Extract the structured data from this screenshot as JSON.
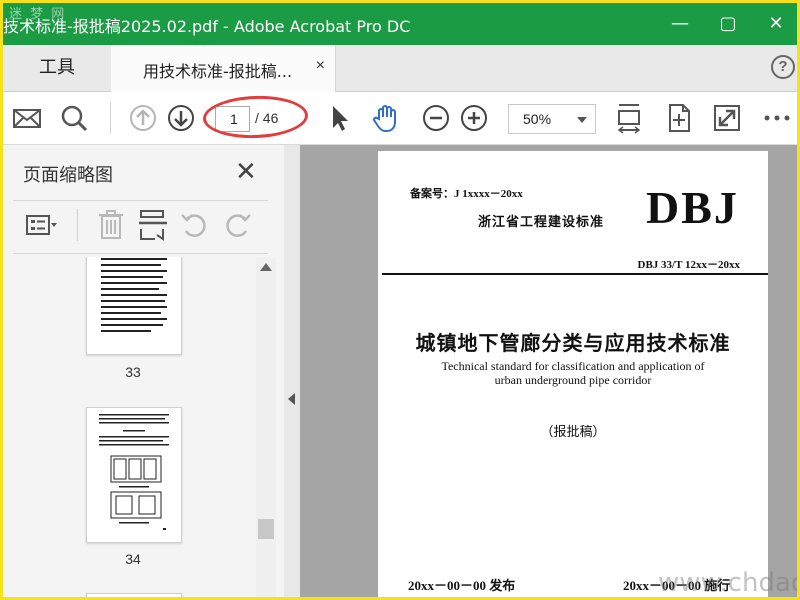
{
  "window": {
    "title": "技术标准-报批稿2025.02.pdf - Adobe Acrobat Pro DC",
    "watermark_top": "迷 梦 网"
  },
  "tabs": {
    "tools_label": "工具",
    "doc_label": "用技术标准-报批稿...",
    "doc_close": "×",
    "help": "?"
  },
  "toolbar": {
    "current_page": "1",
    "total_pages": "/ 46",
    "zoom": "50%"
  },
  "thumbnail_panel": {
    "title": "页面缩略图",
    "close": "✕",
    "pages": [
      {
        "label": "33"
      },
      {
        "label": "34"
      }
    ]
  },
  "document": {
    "record_number": "备案号：J 1xxxx－20xx",
    "standard_type": "浙江省工程建设标准",
    "brand": "DBJ",
    "code": "DBJ 33/T 12xx－20xx",
    "title_cn": "城镇地下管廊分类与应用技术标准",
    "title_en_line1": "Technical standard for classification and application of",
    "title_en_line2": "urban underground pipe corridor",
    "draft_label": "（报批稿）",
    "publish_date": "20xx－00－00 发布",
    "implement_date": "20xx－00－00 施行"
  },
  "watermark_bottom": "www.chdao.c",
  "colors": {
    "title_bar": "#1a9b44",
    "annotation_oval": "#e33c3c",
    "frame_border": "#f5e21b"
  }
}
